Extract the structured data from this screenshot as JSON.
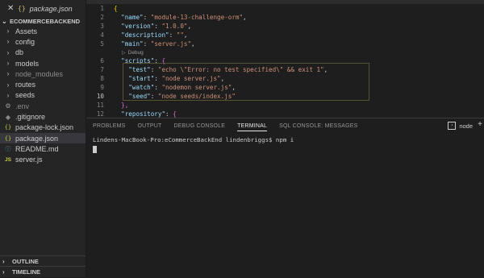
{
  "open_editor": {
    "close": "✕",
    "icon": "{}",
    "name": "package.json"
  },
  "explorer": {
    "project": "ECOMMERCEBACKEND",
    "items": [
      {
        "label": "Assets",
        "icon": "chevron-right-icon",
        "glyph": "›"
      },
      {
        "label": "config",
        "icon": "chevron-right-icon",
        "glyph": "›"
      },
      {
        "label": "db",
        "icon": "chevron-right-icon",
        "glyph": "›"
      },
      {
        "label": "models",
        "icon": "chevron-right-icon",
        "glyph": "›"
      },
      {
        "label": "node_modules",
        "icon": "chevron-right-icon",
        "glyph": "›"
      },
      {
        "label": "routes",
        "icon": "chevron-right-icon",
        "glyph": "›"
      },
      {
        "label": "seeds",
        "icon": "chevron-right-icon",
        "glyph": "›"
      },
      {
        "label": ".env",
        "icon": "gear-icon",
        "glyph": "⚙"
      },
      {
        "label": ".gitignore",
        "icon": "git-icon",
        "glyph": "◆"
      },
      {
        "label": "package-lock.json",
        "icon": "json-braces-icon",
        "glyph": "{}"
      },
      {
        "label": "package.json",
        "icon": "json-braces-icon",
        "glyph": "{}"
      },
      {
        "label": "README.md",
        "icon": "info-icon",
        "glyph": "ⓘ"
      },
      {
        "label": "server.js",
        "icon": "js-file-icon",
        "glyph": "JS"
      }
    ],
    "outline": "OUTLINE",
    "timeline": "TIMELINE"
  },
  "editor": {
    "line_numbers": [
      "1",
      "2",
      "3",
      "4",
      "5",
      "6",
      "7",
      "8",
      "9",
      "10",
      "11",
      "12"
    ],
    "lines": {
      "l1": "{",
      "name_key": "\"name\"",
      "name_val": "\"module-13-challenge-orm\"",
      "version_key": "\"version\"",
      "version_val": "\"1.0.0\"",
      "desc_key": "\"description\"",
      "desc_val": "\"\"",
      "main_key": "\"main\"",
      "main_val": "\"server.js\"",
      "codelens": "Debug",
      "scripts_key": "\"scripts\"",
      "scripts_open": "{",
      "test_key": "\"test\"",
      "test_val": "\"echo \\\"Error: no test specified\\\" && exit 1\"",
      "start_key": "\"start\"",
      "start_val": "\"node server.js\"",
      "watch_key": "\"watch\"",
      "watch_val": "\"nodemon server.js\"",
      "seed_key": "\"seed\"",
      "seed_val": "\"node seeds/index.js\"",
      "scripts_close": "},",
      "repo_key": "\"repository\"",
      "repo_open": "{"
    }
  },
  "panel": {
    "tabs": [
      "PROBLEMS",
      "OUTPUT",
      "DEBUG CONSOLE",
      "TERMINAL",
      "SQL CONSOLE: MESSAGES"
    ],
    "active_tab": "TERMINAL",
    "terminal_select": "node",
    "terminal_line": "Lindens-MacBook-Pro:eCommerceBackEnd lindenbriggs$ npm i"
  }
}
